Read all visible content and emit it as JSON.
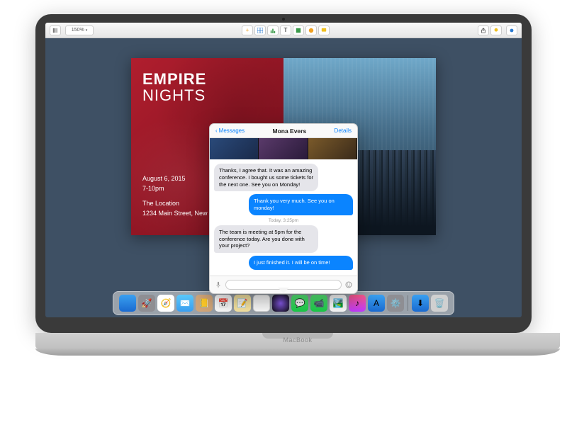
{
  "device": {
    "brand": "MacBook"
  },
  "toolbar": {
    "zoom": "150%"
  },
  "slide": {
    "title_l1": "EMPIRE",
    "title_l2": "NIGHTS",
    "date": "August 6, 2015",
    "time": "7-10pm",
    "location_name": "The Location",
    "location_addr": "1234 Main Street, New"
  },
  "messages": {
    "back": "Messages",
    "contact": "Mona Evers",
    "details": "Details",
    "bubbles": [
      {
        "dir": "in",
        "text": "Thanks, I agree that. It was an amazing conference. I bought us some tickets for the next one. See you on Monday!"
      },
      {
        "dir": "out",
        "text": "Thank you very much. See you on monday!"
      },
      {
        "dir": "ts",
        "text": "Today, 3:25pm"
      },
      {
        "dir": "in",
        "text": "The team is meeting at 5pm for the conference today. Are you done with your project?"
      },
      {
        "dir": "out",
        "text": "I just finished it. I will be on time!"
      }
    ]
  },
  "dock": {
    "apps": [
      "finder",
      "launchpad",
      "safari",
      "mail",
      "contacts",
      "calendar",
      "notes",
      "reminders",
      "siri",
      "messages",
      "facetime",
      "photos",
      "itunes",
      "appstore",
      "system-preferences"
    ],
    "right": [
      "downloads",
      "trash"
    ]
  }
}
